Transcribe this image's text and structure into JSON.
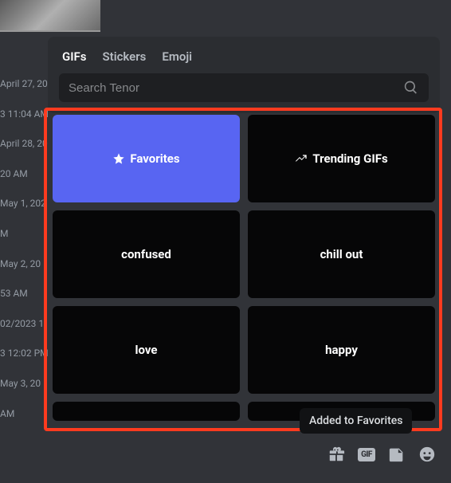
{
  "tabs": {
    "gifs": "GIFs",
    "stickers": "Stickers",
    "emoji": "Emoji"
  },
  "search": {
    "placeholder": "Search Tenor"
  },
  "tiles": {
    "favorites": "Favorites",
    "trending": "Trending GIFs",
    "confused": "confused",
    "chill_out": "chill out",
    "love": "love",
    "happy": "happy"
  },
  "tooltip": "Added to Favorites",
  "timestamps": [
    "April 27, 20",
    "3 11:04 AM",
    "April 28, 20",
    "20 AM",
    "May 1, 202",
    "M",
    "May 2, 20",
    "53 AM",
    "02/2023 1",
    "3 12:02 PM",
    "May 3, 20",
    "AM"
  ],
  "toolbar": {
    "gif_label": "GIF"
  }
}
